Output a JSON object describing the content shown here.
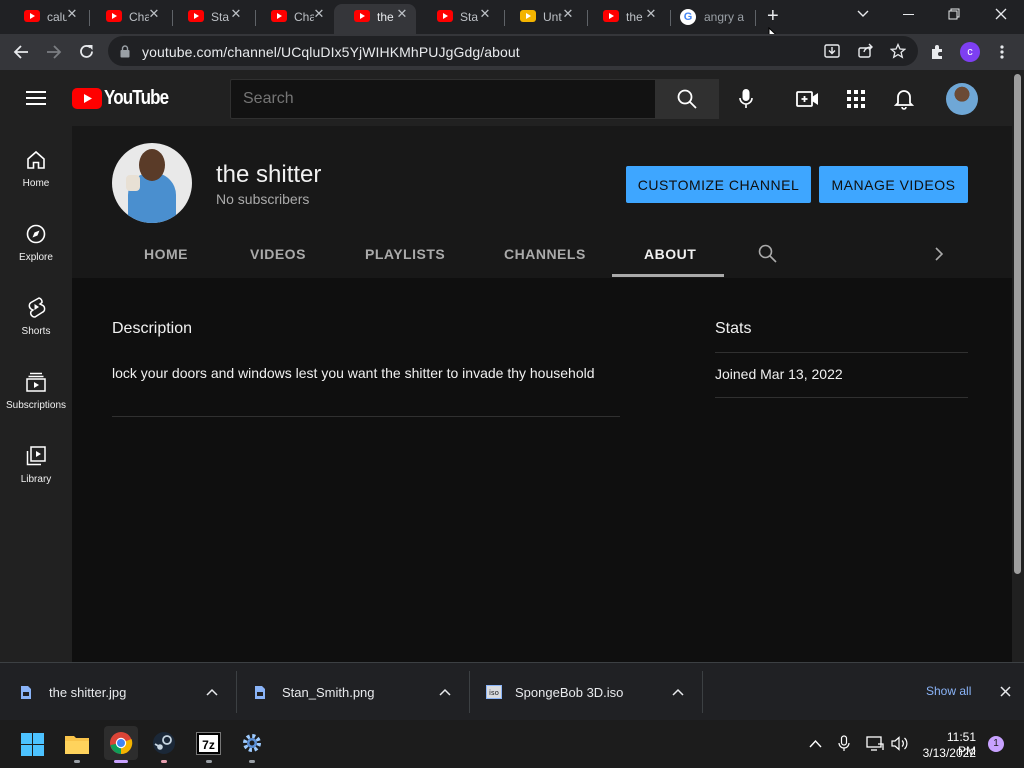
{
  "browser": {
    "tabs": [
      {
        "title": "calu",
        "favicon": "youtube"
      },
      {
        "title": "Cha",
        "favicon": "youtube"
      },
      {
        "title": "Sta",
        "favicon": "youtube"
      },
      {
        "title": "Cha",
        "favicon": "youtube"
      },
      {
        "title": "the",
        "favicon": "youtube",
        "active": true
      },
      {
        "title": "Sta",
        "favicon": "youtube"
      },
      {
        "title": "Unt",
        "favicon": "slides"
      },
      {
        "title": "the",
        "favicon": "youtube"
      },
      {
        "title": "angry a",
        "favicon": "google"
      }
    ],
    "new_tab": "+",
    "url": "youtube.com/channel/UCqluDIx5YjWIHKMhPUJgGdg/about",
    "profile_initial": "c"
  },
  "youtube": {
    "logo_text": "YouTube",
    "search_placeholder": "Search",
    "sidebar": [
      {
        "label": "Home",
        "icon": "home-icon"
      },
      {
        "label": "Explore",
        "icon": "compass-icon"
      },
      {
        "label": "Shorts",
        "icon": "shorts-icon"
      },
      {
        "label": "Subscriptions",
        "icon": "subscriptions-icon"
      },
      {
        "label": "Library",
        "icon": "library-icon"
      }
    ],
    "channel": {
      "name": "the shitter",
      "subscribers": "No subscribers",
      "customize_label": "CUSTOMIZE CHANNEL",
      "manage_label": "MANAGE VIDEOS",
      "tabs": [
        "HOME",
        "VIDEOS",
        "PLAYLISTS",
        "CHANNELS",
        "ABOUT"
      ],
      "active_tab": "ABOUT"
    },
    "about": {
      "description_heading": "Description",
      "description_text": "lock your doors and windows lest you want the shitter to invade thy household",
      "stats_heading": "Stats",
      "joined": "Joined Mar 13, 2022"
    }
  },
  "downloads": {
    "items": [
      {
        "name": "the shitter.jpg"
      },
      {
        "name": "Stan_Smith.png"
      },
      {
        "name": "SpongeBob 3D.iso"
      }
    ],
    "show_all": "Show all"
  },
  "taskbar": {
    "time": "11:51 PM",
    "date": "3/13/2022",
    "notification_count": "1",
    "apps": [
      "start",
      "file-explorer",
      "chrome",
      "steam",
      "7zip",
      "settings"
    ]
  },
  "colors": {
    "accent_blue": "#3ea6ff",
    "youtube_red": "#ff0000",
    "background": "#0f0f0f"
  }
}
